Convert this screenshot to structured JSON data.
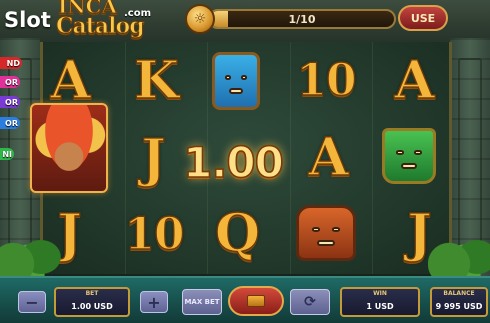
{
  "logo": {
    "slot": "Slot",
    "com": ".com",
    "inca": "INCA",
    "catalog": "Catalog"
  },
  "progress": {
    "label": "1/10",
    "fraction": 0.1,
    "use_label": "USE",
    "coin_icon": "aztec-coin-icon"
  },
  "paytable_tabs": [
    {
      "text": "ND",
      "color": "#d62828"
    },
    {
      "text": "OR",
      "color": "#e0309a"
    },
    {
      "text": "OR",
      "color": "#7a3ad6"
    },
    {
      "text": "OR",
      "color": "#2a7ee0"
    },
    {
      "text": "NI",
      "color": "#2fb84a"
    }
  ],
  "reels": {
    "row1": [
      "A",
      "K",
      "blue-mask",
      "10",
      "A"
    ],
    "row2": [
      "chief",
      "J",
      "",
      "A",
      "green-mask"
    ],
    "row3": [
      "J",
      "10",
      "Q",
      "orange-mask",
      "J"
    ]
  },
  "symbols": {
    "r1c1": "A",
    "r1c2": "K",
    "r1c4": "10",
    "r1c5": "A",
    "r2c2": "J",
    "r2c4": "A",
    "r3c1": "J",
    "r3c2": "10",
    "r3c3": "Q",
    "r3c5": "J"
  },
  "win_overlay": "1.00",
  "controls": {
    "minus": "−",
    "plus": "+",
    "bet_label": "BET",
    "bet_value": "1.00 USD",
    "max_bet": "MAX BET",
    "spin_icon": "spin-icon",
    "auto_icon": "autoplay-icon",
    "win_label": "WIN",
    "win_value": "1 USD",
    "balance_label": "BALANCE",
    "balance_value": "9 995 USD"
  }
}
